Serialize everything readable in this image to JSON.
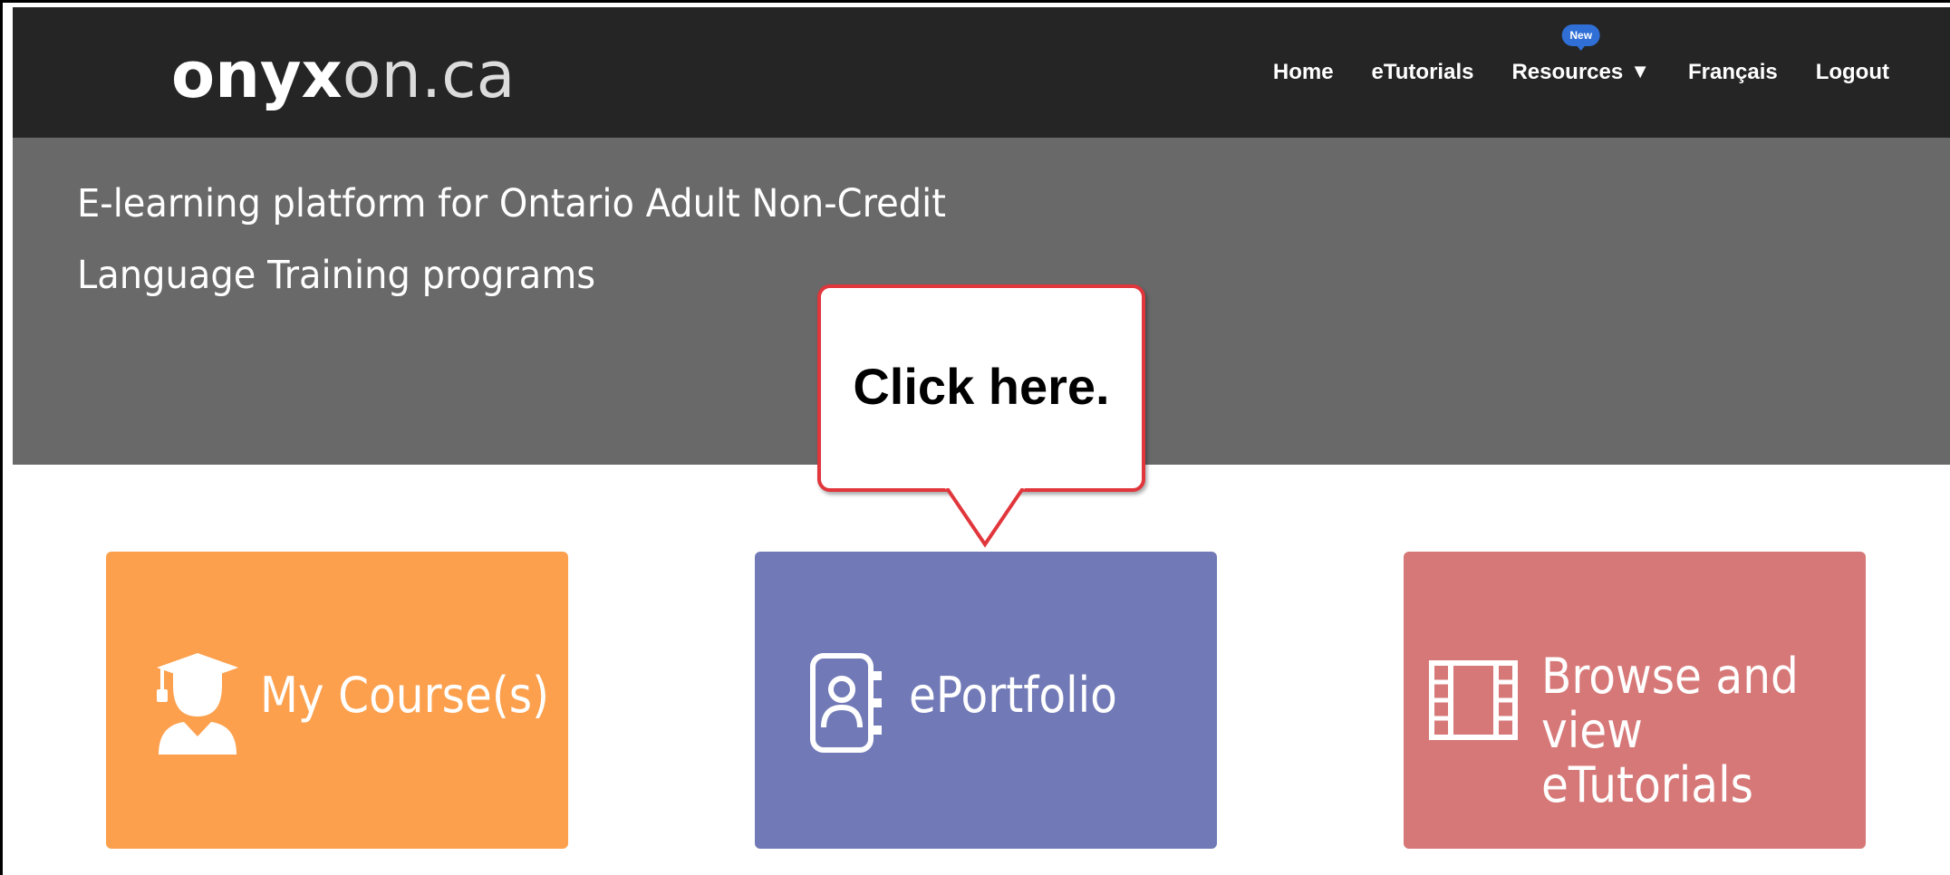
{
  "header": {
    "logo_brand": "onyx",
    "logo_domain": "on.ca",
    "nav": [
      {
        "label": "Home"
      },
      {
        "label": "eTutorials"
      },
      {
        "label": "Resources",
        "badge": "New",
        "has_dropdown": true
      },
      {
        "label": "Français"
      },
      {
        "label": "Logout"
      }
    ]
  },
  "hero": {
    "line1": "E-learning platform for Ontario Adult Non-Credit",
    "line2": "Language Training programs"
  },
  "callout": {
    "text": "Click here."
  },
  "tiles": [
    {
      "label": "My Course(s)",
      "icon": "graduate-icon",
      "color": "#fca04d"
    },
    {
      "label": "ePortfolio",
      "icon": "address-book-icon",
      "color": "#717ab7"
    },
    {
      "label_line1": "Browse and",
      "label_line2": "view eTutorials",
      "icon": "film-strip-icon",
      "color": "#d77878"
    }
  ],
  "colors": {
    "topbar": "#252525",
    "hero": "#696969",
    "callout_border": "#e0363c",
    "badge": "#2f6fd6"
  }
}
